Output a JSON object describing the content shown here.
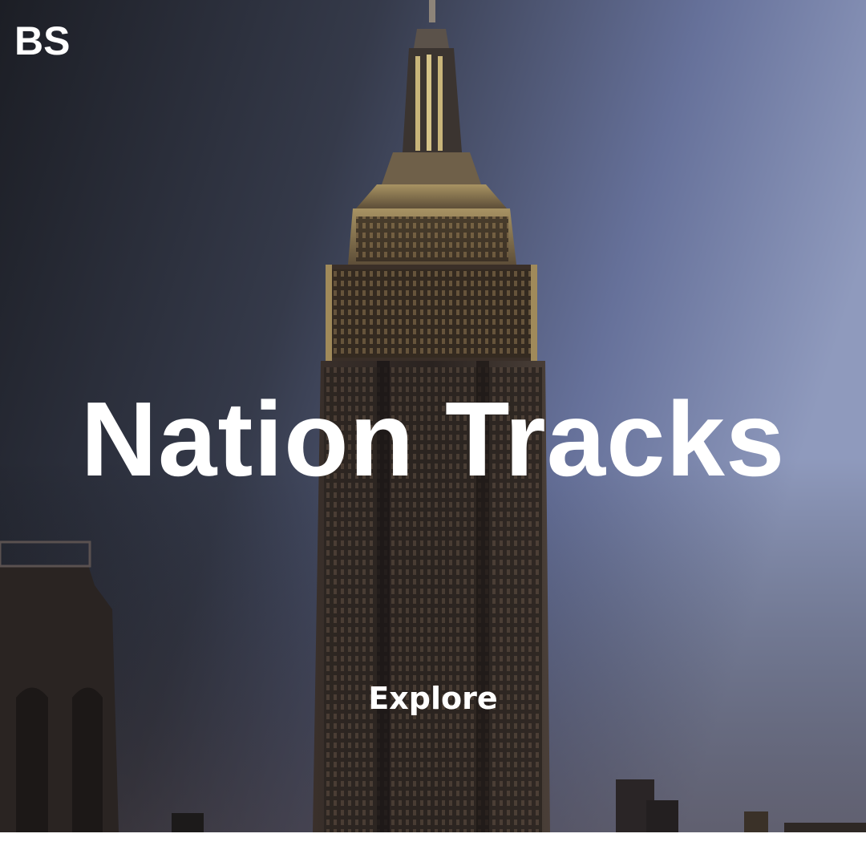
{
  "brand": {
    "logo_text": "BS"
  },
  "hero": {
    "title": "Nation Tracks",
    "cta_label": "Explore",
    "image_subject": "empire-state-building-at-dusk"
  },
  "colors": {
    "text": "#ffffff",
    "sky_dark": "#1d1f27",
    "sky_light": "#8792b4",
    "page_background": "#ffffff"
  }
}
